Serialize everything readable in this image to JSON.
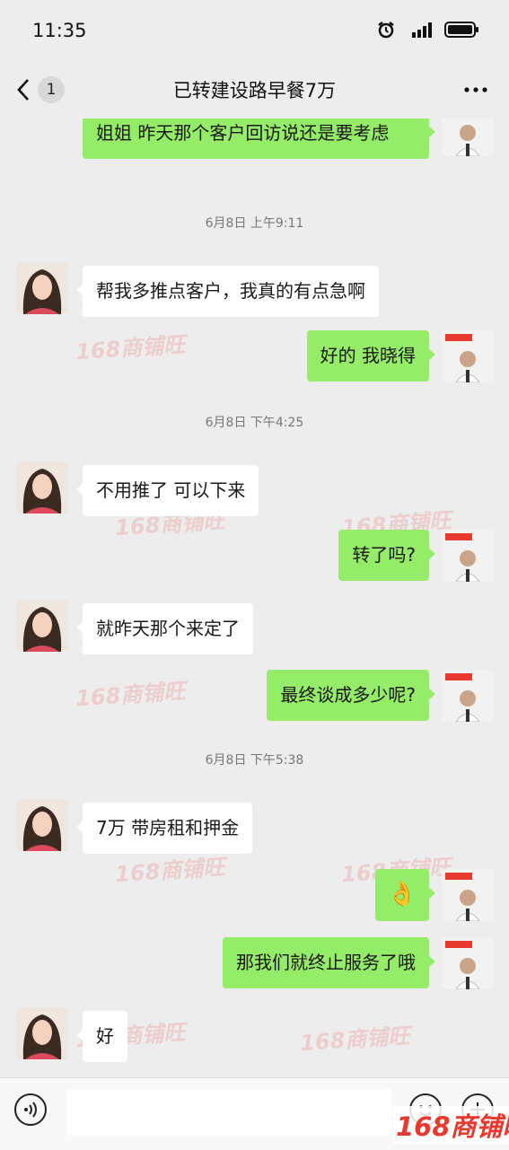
{
  "status_bar": {
    "time": "11:35",
    "icons": [
      "alarm-icon",
      "signal-icon",
      "battery-icon"
    ]
  },
  "nav": {
    "back_icon": "chevron-left-icon",
    "unread_count": "1",
    "title": "已转建设路早餐7万",
    "more_icon": "more-dots-icon"
  },
  "messages": [
    {
      "side": "right",
      "text": "姐姐 昨天那个客户回访说还是要考虑"
    },
    {
      "timestamp": "6月8日 上午9:11"
    },
    {
      "side": "left",
      "text": "帮我多推点客户，我真的有点急啊"
    },
    {
      "side": "right",
      "text": "好的 我晓得"
    },
    {
      "timestamp": "6月8日 下午4:25"
    },
    {
      "side": "left",
      "text": "不用推了 可以下来"
    },
    {
      "side": "right",
      "text": "转了吗?"
    },
    {
      "side": "left",
      "text": "就昨天那个来定了"
    },
    {
      "side": "right",
      "text": "最终谈成多少呢?"
    },
    {
      "timestamp": "6月8日 下午5:38"
    },
    {
      "side": "left",
      "text": "7万 带房租和押金"
    },
    {
      "side": "right",
      "emoji": "👌"
    },
    {
      "side": "right",
      "text": "那我们就终止服务了哦"
    },
    {
      "side": "left",
      "text": "好"
    }
  ],
  "watermark": {
    "text": "168商铺旺"
  },
  "input_bar": {
    "voice_icon": "voice-icon",
    "emoji_icon": "emoji-icon",
    "plus_icon": "plus-icon"
  },
  "colors": {
    "background": "#ededed",
    "sent_bubble": "#95ec69",
    "received_bubble": "#ffffff",
    "watermark": "#e8392e"
  }
}
